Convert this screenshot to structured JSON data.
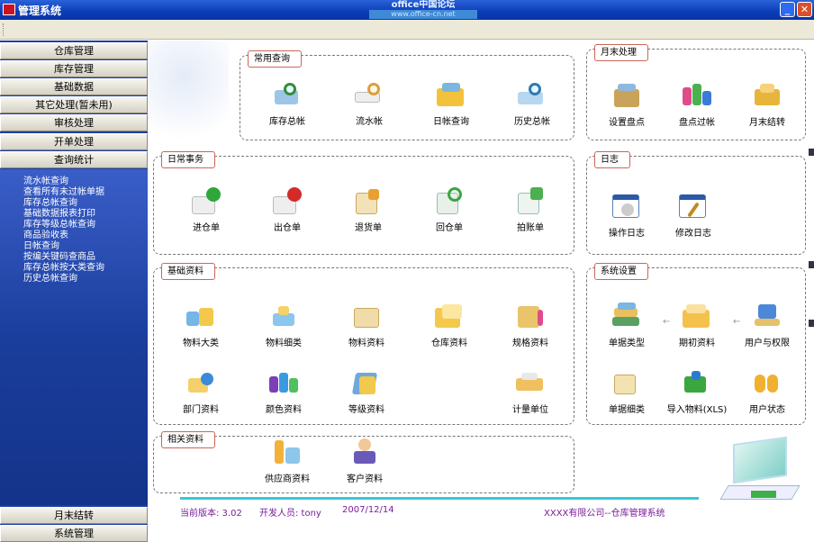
{
  "window": {
    "title": "管理系统",
    "banner_line1": "office中国论坛",
    "banner_line2": "www.office-cn.net"
  },
  "sidebar": {
    "top_menu": [
      "仓库管理",
      "库存管理",
      "基础数据",
      "其它处理(暂未用)",
      "审核处理",
      "开单处理",
      "查询统计"
    ],
    "sub_items": [
      "流水帐查询",
      "查看所有未过帐单据",
      "库存总帐查询",
      "基础数据报表打印",
      "库存等级总帐查询",
      "商品验收表",
      "日帐查询",
      "按编关键码查商品",
      "库存总帐按大类查询",
      "历史总帐查询"
    ],
    "bottom_menu": [
      "月末结转",
      "系统管理"
    ]
  },
  "groups": {
    "common_query": {
      "title": "常用查询",
      "items": [
        "库存总帐",
        "流水帐",
        "日帐查询",
        "历史总帐"
      ]
    },
    "month_end": {
      "title": "月末处理",
      "items": [
        "设置盘点",
        "盘点过帐",
        "月末结转"
      ]
    },
    "daily": {
      "title": "日常事务",
      "items": [
        "进仓单",
        "出仓单",
        "退货单",
        "回仓单",
        "拍账单"
      ]
    },
    "log": {
      "title": "日志",
      "items": [
        "操作日志",
        "修改日志"
      ]
    },
    "basic": {
      "title": "基础资料",
      "items": [
        "物料大类",
        "物料细类",
        "物料资料",
        "仓库资料",
        "规格资料",
        "部门资料",
        "颜色资料",
        "等级资料",
        "计量单位"
      ]
    },
    "system": {
      "title": "系统设置",
      "items": [
        "单据类型",
        "期初资料",
        "用户与权限",
        "单据细类",
        "导入物料(XLS)",
        "用户状态"
      ]
    },
    "related": {
      "title": "相关资料",
      "items": [
        "供应商资料",
        "客户资料"
      ]
    }
  },
  "status": {
    "version": "当前版本: 3.02",
    "developer": "开发人员: tony",
    "date": "2007/12/14",
    "company": "XXXX有限公司--仓库管理系统"
  },
  "colors": {
    "titlebar": "#0b3cb8",
    "sidebar": "#1f3fa0",
    "status_text": "#7a1b9a",
    "status_line": "#36c8d6"
  }
}
